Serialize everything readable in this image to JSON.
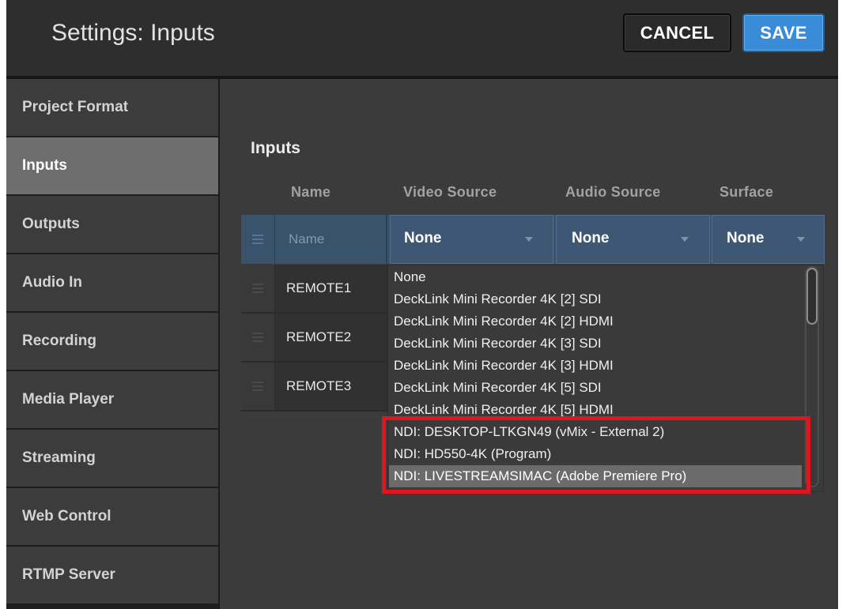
{
  "window": {
    "title": "Settings: Inputs"
  },
  "header": {
    "cancel_label": "CANCEL",
    "save_label": "SAVE"
  },
  "sidebar": {
    "items": [
      {
        "label": "Project Format",
        "selected": false
      },
      {
        "label": "Inputs",
        "selected": true
      },
      {
        "label": "Outputs",
        "selected": false
      },
      {
        "label": "Audio In",
        "selected": false
      },
      {
        "label": "Recording",
        "selected": false
      },
      {
        "label": "Media Player",
        "selected": false
      },
      {
        "label": "Streaming",
        "selected": false
      },
      {
        "label": "Web Control",
        "selected": false
      },
      {
        "label": "RTMP Server",
        "selected": false
      }
    ]
  },
  "inputs": {
    "section_title": "Inputs",
    "columns": {
      "name": "Name",
      "video_source": "Video Source",
      "audio_source": "Audio Source",
      "surface": "Surface"
    },
    "new_input": {
      "name_placeholder": "Name",
      "video_source": "None",
      "audio_source": "None",
      "surface": "None"
    },
    "rows": [
      {
        "name": "REMOTE1"
      },
      {
        "name": "REMOTE2"
      },
      {
        "name": "REMOTE3"
      }
    ],
    "video_source_dropdown": {
      "open": true,
      "options": [
        {
          "label": "None",
          "highlighted": false
        },
        {
          "label": "DeckLink Mini Recorder 4K [2] SDI",
          "highlighted": false
        },
        {
          "label": "DeckLink Mini Recorder 4K [2] HDMI",
          "highlighted": false
        },
        {
          "label": "DeckLink Mini Recorder 4K [3] SDI",
          "highlighted": false
        },
        {
          "label": "DeckLink Mini Recorder 4K [3] HDMI",
          "highlighted": false
        },
        {
          "label": "DeckLink Mini Recorder 4K [5] SDI",
          "highlighted": false
        },
        {
          "label": "DeckLink Mini Recorder 4K [5] HDMI",
          "highlighted": false
        },
        {
          "label": "NDI: DESKTOP-LTKGN49 (vMix - External 2)",
          "highlighted": false
        },
        {
          "label": "NDI: HD550-4K (Program)",
          "highlighted": false
        },
        {
          "label": "NDI: LIVESTREAMSIMAC (Adobe Premiere Pro)",
          "highlighted": true
        }
      ]
    }
  },
  "icons": {
    "row_handle": "drag-handle-icon",
    "select_caret": "chevron-down-icon"
  },
  "colors": {
    "save_button": "#3b8cd8",
    "selected_nav_item": "#6e6e6e",
    "table_header_row": "#3a536d",
    "highlighted_option": "#6b6b6b",
    "annotation_box": "#e3141c"
  }
}
